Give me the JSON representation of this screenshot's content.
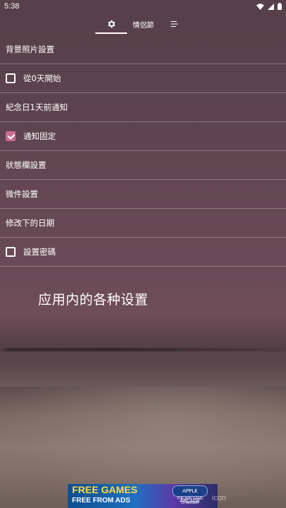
{
  "status_bar": {
    "time": "5:38"
  },
  "tabs": {
    "couple": "情侶節"
  },
  "settings": [
    {
      "label": "背景照片設置",
      "type": "item"
    },
    {
      "label": "從0天開始",
      "type": "checkbox",
      "checked": false
    },
    {
      "label": "紀念日1天前通知",
      "type": "item"
    },
    {
      "label": "通知固定",
      "type": "checkbox",
      "checked": true
    },
    {
      "label": "狀態欄設置",
      "type": "item"
    },
    {
      "label": "微件設置",
      "type": "item"
    },
    {
      "label": "修改下的日期",
      "type": "item"
    },
    {
      "label": "設置密碼",
      "type": "checkbox",
      "checked": false
    }
  ],
  "caption": "应用内的各种设置",
  "ad": {
    "headline": "FREE GAMES",
    "subline": "FREE FROM ADS",
    "badge": "APPLE ARCADE",
    "tagline": "THE WIN GAME CHANGER"
  },
  "watermark": "icon",
  "colors": {
    "accent": "#c96b8d",
    "text": "#ffffff"
  }
}
